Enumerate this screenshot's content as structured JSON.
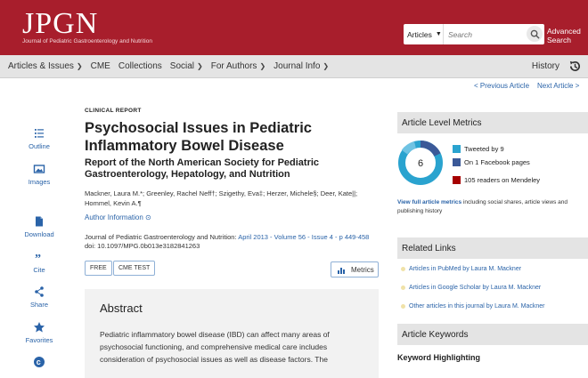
{
  "header": {
    "logo_text": "JPGN",
    "logo_subtitle": "Journal of Pediatric Gastroenterology and Nutrition",
    "search_scope": "Articles",
    "search_placeholder": "Search",
    "advanced_search_line1": "Advanced",
    "advanced_search_line2": "Search"
  },
  "nav": {
    "items": [
      {
        "label": "Articles & Issues",
        "dropdown": true
      },
      {
        "label": "CME",
        "dropdown": false
      },
      {
        "label": "Collections",
        "dropdown": false
      },
      {
        "label": "Social",
        "dropdown": true
      },
      {
        "label": "For Authors",
        "dropdown": true
      },
      {
        "label": "Journal Info",
        "dropdown": true
      }
    ],
    "history": "History"
  },
  "pager": {
    "previous": "< Previous Article",
    "next": "Next Article >"
  },
  "toolbar": [
    {
      "label": "Outline",
      "icon": "outline-icon"
    },
    {
      "label": "Images",
      "icon": "images-icon"
    },
    {
      "label": "Download",
      "icon": "download-icon"
    },
    {
      "label": "Cite",
      "icon": "quote-icon"
    },
    {
      "label": "Share",
      "icon": "share-icon"
    },
    {
      "label": "Favorites",
      "icon": "star-icon"
    }
  ],
  "article": {
    "section": "CLINICAL REPORT",
    "title": "Psychosocial Issues in Pediatric Inflammatory Bowel Disease",
    "subtitle": "Report of the North American Society for Pediatric Gastroenterology, Hepatology, and Nutrition",
    "authors": "Mackner, Laura M.*; Greenley, Rachel Neff†; Szigethy, Eva‡; Herzer, Michele§; Deer, Kate||; Hommel, Kevin A.¶",
    "author_info": "Author Information",
    "journal_prefix": "Journal of Pediatric Gastroenterology and Nutrition: ",
    "journal_citation": "April 2013 - Volume 56 - Issue 4 - p 449-458",
    "doi": "doi: 10.1097/MPG.0b013e3182841263",
    "tags": [
      "FREE",
      "CME TEST"
    ],
    "metrics_button": "Metrics",
    "abstract_heading": "Abstract",
    "abstract_text": "Pediatric inflammatory bowel disease (IBD) can affect many areas of psychosocial functioning, and comprehensive medical care includes consideration of psychosocial issues as well as disease factors. The"
  },
  "sidebar": {
    "metrics_heading": "Article Level Metrics",
    "altmetric_score": "6",
    "altmetric_rows": [
      {
        "text": "Tweeted by 9",
        "color": "#2aa3cf"
      },
      {
        "text": "On 1 Facebook pages",
        "color": "#3b5998"
      },
      {
        "text": "105 readers on Mendeley",
        "color": "#a60000"
      }
    ],
    "view_full_link": "View full article metrics",
    "view_full_rest": " including social shares, article views and publishing history",
    "related_heading": "Related Links",
    "related_links": [
      "Articles in PubMed by Laura M. Mackner",
      "Articles in Google Scholar by Laura M. Mackner",
      "Other articles in this journal by Laura M. Mackner"
    ],
    "keywords_heading": "Article Keywords",
    "keyword_highlighting": "Keyword Highlighting"
  },
  "colors": {
    "brand_red": "#a81e2c",
    "link_blue": "#2a63a8",
    "nav_gray": "#e4e4e4"
  }
}
